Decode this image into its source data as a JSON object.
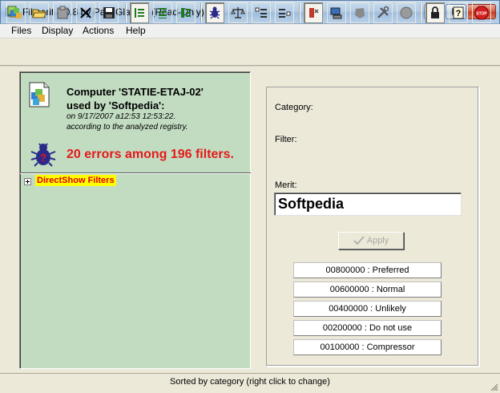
{
  "window": {
    "title": "Filmerit 3.0.8 by Paul Glagla - (Read-Only)"
  },
  "menu": [
    "Files",
    "Display",
    "Actions",
    "Help"
  ],
  "toolbar": {
    "buttons": [
      "open-wizard",
      "open-folder",
      "paste",
      "cross",
      "save",
      "list-view",
      "list-view-2",
      "list-view-3",
      "bug",
      "balance",
      "sort-list",
      "filter-list",
      "delete",
      "monitor",
      "blob",
      "tools",
      "circle",
      "lock",
      "help",
      "stop"
    ]
  },
  "computer_info": {
    "line1": "Computer 'STATIE-ETAJ-02'",
    "line2": "used by 'Softpedia':",
    "date": "on 9/17/2007 a12:53 12:53:22.",
    "source": "according to the analyzed registry."
  },
  "errors_summary": "20 errors among 196 filters.",
  "tree": {
    "node_label": "DirectShow Filters"
  },
  "details": {
    "category_label": "Category:",
    "filter_label": "Filter:",
    "merit_label": "Merit:",
    "merit_value": "Softpedia",
    "apply_label": "Apply"
  },
  "merit_options": [
    "00800000 : Preferred",
    "00600000 : Normal",
    "00400000 : Unlikely",
    "00200000 : Do not use",
    "00100000 : Compressor"
  ],
  "status": "Sorted by category (right click to change)",
  "colors": {
    "left_panel_bg": "#c2dcc2",
    "error_red": "#e41a1a",
    "highlight": "#ffff00"
  }
}
